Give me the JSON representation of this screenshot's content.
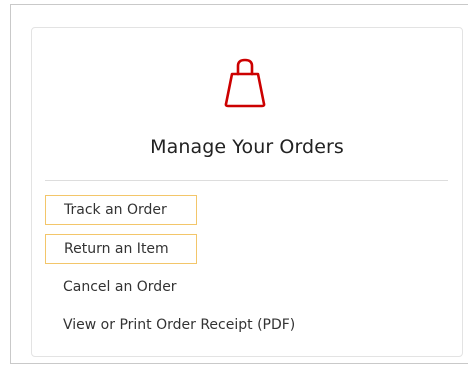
{
  "orders_card": {
    "icon": "shopping-bag-icon",
    "icon_color": "#cc0000",
    "title": "Manage Your Orders",
    "highlight_color": "#f3c66a",
    "links": [
      {
        "label": "Track an Order",
        "highlighted": true
      },
      {
        "label": "Return an Item",
        "highlighted": true
      },
      {
        "label": "Cancel an Order",
        "highlighted": false
      },
      {
        "label": "View or Print Order Receipt (PDF)",
        "highlighted": false
      }
    ]
  }
}
